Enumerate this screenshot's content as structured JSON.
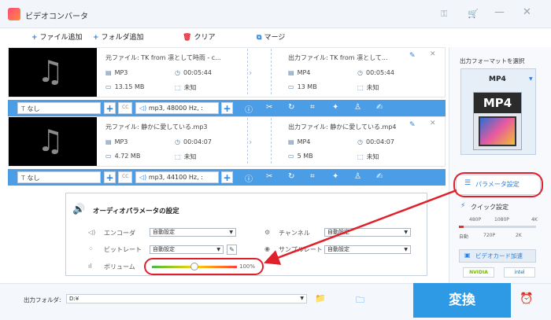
{
  "window": {
    "title": "ビデオコンバータ"
  },
  "toolbar": {
    "add_file": "ファイル追加",
    "add_folder": "フォルダ追加",
    "clear": "クリア",
    "merge": "マージ"
  },
  "files": [
    {
      "source_label": "元ファイル: TK from 凛として時雨 - c...",
      "source_format": "MP3",
      "source_duration": "00:05:44",
      "source_size": "13.15 MB",
      "source_resolution": "未知",
      "output_label": "出力ファイル: TK from 凛として...",
      "output_format": "MP4",
      "output_duration": "00:05:44",
      "output_size": "13 MB",
      "output_resolution": "未知",
      "subtitle": "なし",
      "audio": "mp3, 48000 Hz, :"
    },
    {
      "source_label": "元ファイル: 静かに愛している.mp3",
      "source_format": "MP3",
      "source_duration": "00:04:07",
      "source_size": "4.72 MB",
      "source_resolution": "未知",
      "output_label": "出力ファイル: 静かに愛している.mp4",
      "output_format": "MP4",
      "output_duration": "00:04:07",
      "output_size": "5 MB",
      "output_resolution": "未知",
      "subtitle": "なし",
      "audio": "mp3, 44100 Hz, :"
    }
  ],
  "audio_params": {
    "title": "オーディオパラメータの設定",
    "encoder_label": "エンコーダ",
    "encoder_value": "自動設定",
    "bitrate_label": "ビットレート",
    "bitrate_value": "自動設定",
    "volume_label": "ボリューム",
    "volume_value": "100%",
    "volume_level": 0.5,
    "channel_label": "チャンネル",
    "channel_value": "自動設定",
    "samplerate_label": "サンプルレート",
    "samplerate_value": "自動設定"
  },
  "right_panel": {
    "output_format_label": "出力フォーマットを選択",
    "format_value": "MP4",
    "card_text": "MP4",
    "param_settings": "パラメータ設定",
    "quick_settings": "クイック設定",
    "quick_top": [
      "480P",
      "1080P",
      "4K"
    ],
    "quick_bottom": [
      "自動",
      "720P",
      "2K"
    ],
    "gpu_accel": "ビデオカード加速",
    "gpu_brands": [
      "NVIDIA",
      "intel"
    ]
  },
  "bottom": {
    "output_folder_label": "出力フォルダ:",
    "output_folder_value": "D:¥",
    "convert": "変換"
  },
  "colors": {
    "accent": "#2e9ae6",
    "highlight": "#e0202a",
    "editbar": "#4b9de6"
  }
}
